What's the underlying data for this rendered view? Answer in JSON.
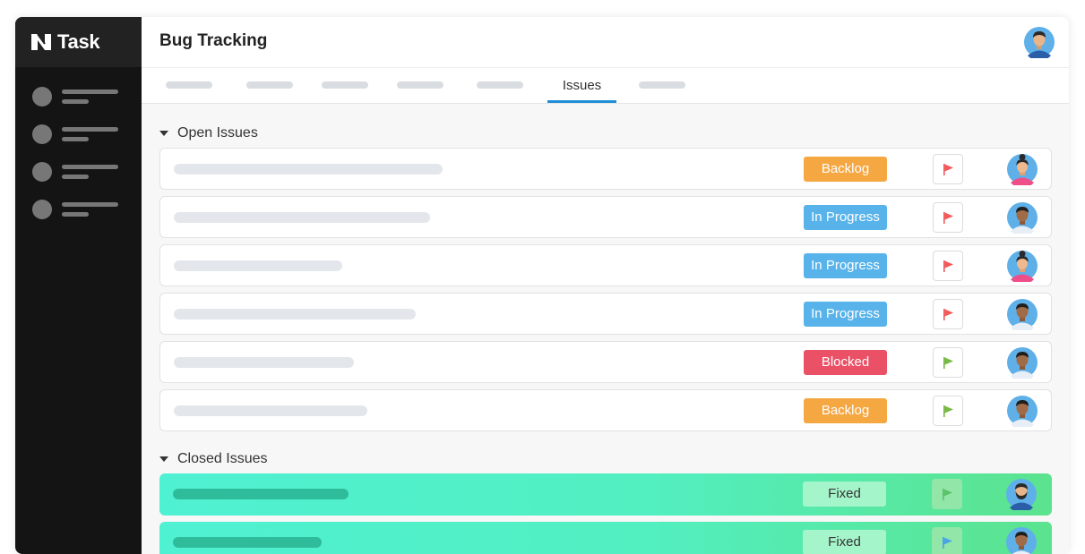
{
  "app": {
    "name": "Task"
  },
  "header": {
    "title": "Bug Tracking"
  },
  "tabs": {
    "active_label": "Issues"
  },
  "sections": {
    "open": {
      "label": "Open Issues"
    },
    "closed": {
      "label": "Closed Issues"
    }
  },
  "open_issues": [
    {
      "status": "Backlog",
      "status_color": "#f5a742",
      "flag_color": "#f25a5a",
      "assignee": "woman-avatar"
    },
    {
      "status": "In Progress",
      "status_color": "#57b3ea",
      "flag_color": "#f25a5a",
      "assignee": "man-avatar"
    },
    {
      "status": "In Progress",
      "status_color": "#57b3ea",
      "flag_color": "#f25a5a",
      "assignee": "woman-avatar"
    },
    {
      "status": "In Progress",
      "status_color": "#57b3ea",
      "flag_color": "#f25a5a",
      "assignee": "man-avatar"
    },
    {
      "status": "Blocked",
      "status_color": "#ea5166",
      "flag_color": "#78b844",
      "assignee": "man-avatar"
    },
    {
      "status": "Backlog",
      "status_color": "#f5a742",
      "flag_color": "#78b844",
      "assignee": "man-avatar"
    }
  ],
  "closed_issues": [
    {
      "status": "Fixed",
      "flag_color": "#5cc36a",
      "assignee": "bearded-man-avatar"
    },
    {
      "status": "Fixed",
      "flag_color": "#4aa3e6",
      "assignee": "man-avatar"
    }
  ],
  "colors": {
    "sidebar_bg": "#141414",
    "brand_bg": "#222222",
    "tab_accent": "#1f8ed6",
    "closed_gradient_start": "#4ff1d3",
    "closed_gradient_end": "#5be38e"
  }
}
